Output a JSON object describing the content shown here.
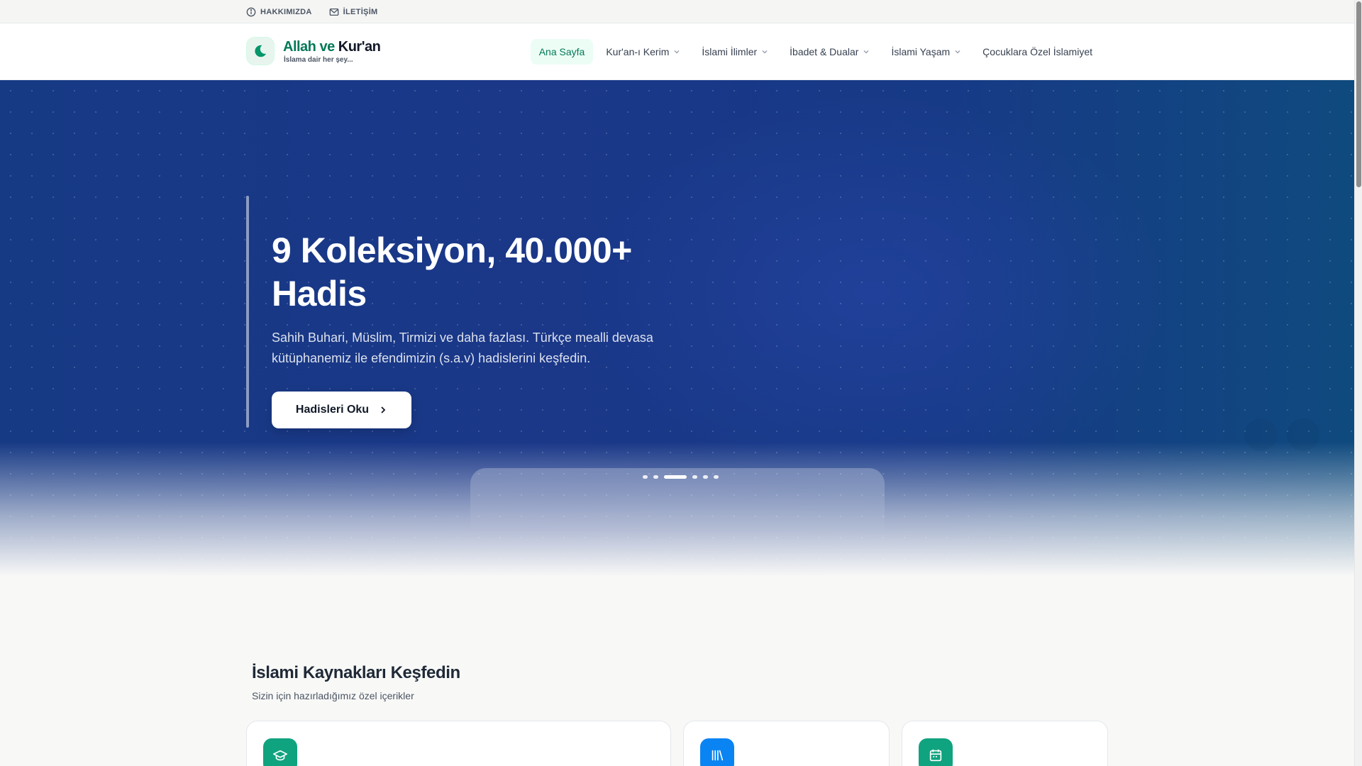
{
  "topbar": {
    "about_label": "HAKKIMIZDA",
    "contact_label": "İLETİŞİM"
  },
  "brand": {
    "title_part1": "Allah ve",
    "title_part2": "Kur'an",
    "tagline": "İslama dair her şey..."
  },
  "nav": {
    "items": [
      {
        "label": "Ana Sayfa",
        "active": true,
        "dropdown": false
      },
      {
        "label": "Kur'an-ı Kerim",
        "active": false,
        "dropdown": true
      },
      {
        "label": "İslami İlimler",
        "active": false,
        "dropdown": true
      },
      {
        "label": "İbadet & Dualar",
        "active": false,
        "dropdown": true
      },
      {
        "label": "İslami Yaşam",
        "active": false,
        "dropdown": true
      },
      {
        "label": "Çocuklara Özel İslamiyet",
        "active": false,
        "dropdown": false
      }
    ]
  },
  "hero": {
    "title": "9 Koleksiyon, 40.000+ Hadis",
    "description": "Sahih Buhari, Müslim, Tirmizi ve daha fazlası. Türkçe mealli devasa kütüphanemiz ile efendimizin (s.a.v) hadislerini keşfedin.",
    "button_label": "Hadisleri Oku",
    "slide_count": 6,
    "active_slide": 2
  },
  "section": {
    "title": "İslami Kaynakları Keşfedin",
    "subtitle": "Sizin için hazırladığımız özel içerikler"
  },
  "cards": [
    {
      "icon": "graduation-cap-icon",
      "color": "#10a37f"
    },
    {
      "icon": "library-icon",
      "color": "#0b84f3"
    },
    {
      "icon": "calendar-icon",
      "color": "#10a37f"
    }
  ],
  "colors": {
    "brand_green": "#047857",
    "hero_blue": "#1a3788",
    "active_nav_bg": "#ecfdf5"
  }
}
